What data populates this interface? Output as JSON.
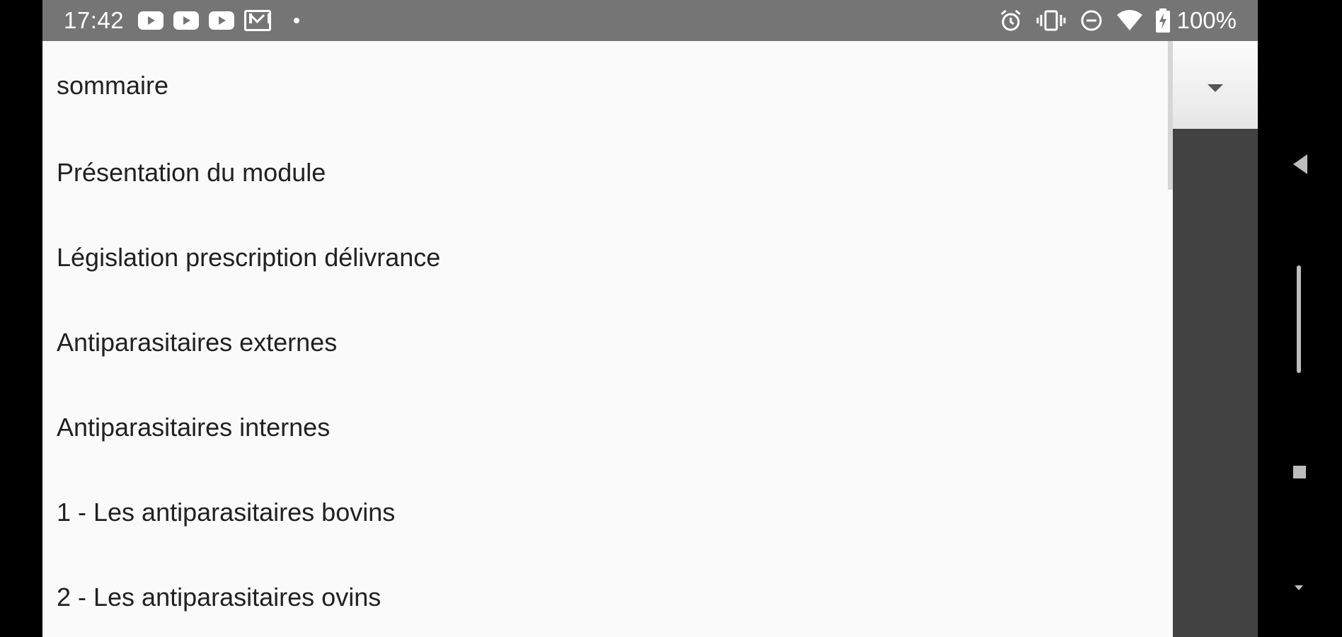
{
  "status_bar": {
    "time": "17:42",
    "notification_icons": [
      "youtube-icon",
      "youtube-icon",
      "youtube-icon",
      "gmail-icon",
      "dot-icon"
    ],
    "system_icons": [
      "alarm-icon",
      "vibrate-icon",
      "do-not-disturb-icon",
      "wifi-icon",
      "battery-charging-icon"
    ],
    "battery": "100%"
  },
  "dropdown": {
    "items": [
      "sommaire",
      "Présentation du module",
      "Législation prescription délivrance",
      "Antiparasitaires externes",
      "Antiparasitaires internes",
      "1 - Les antiparasitaires bovins",
      "2 - Les antiparasitaires ovins"
    ],
    "toggle_icon": "caret-down-icon"
  },
  "nav_bar": {
    "buttons": [
      "back-icon",
      "home-icon",
      "recents-icon",
      "hide-keyboard-icon"
    ]
  }
}
